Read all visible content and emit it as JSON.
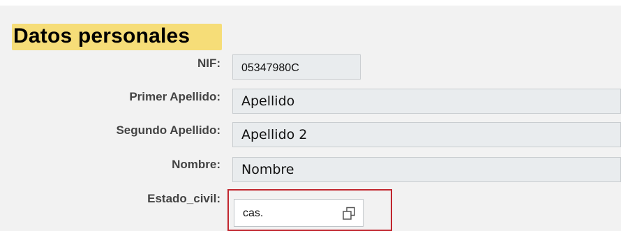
{
  "section": {
    "title": "Datos personales"
  },
  "fields": [
    {
      "label": "NIF:",
      "value": "05347980C"
    },
    {
      "label": "Primer Apellido:",
      "value": "Apellido"
    },
    {
      "label": "Segundo Apellido:",
      "value": "Apellido 2"
    },
    {
      "label": "Nombre:",
      "value": "Nombre"
    },
    {
      "label": "Estado_civil:",
      "value": "cas."
    }
  ],
  "icons": {
    "estado_civil_picker": "value-help-icon"
  },
  "colors": {
    "section_highlight": "#f6dd78",
    "focus_outline": "#c1262e"
  }
}
